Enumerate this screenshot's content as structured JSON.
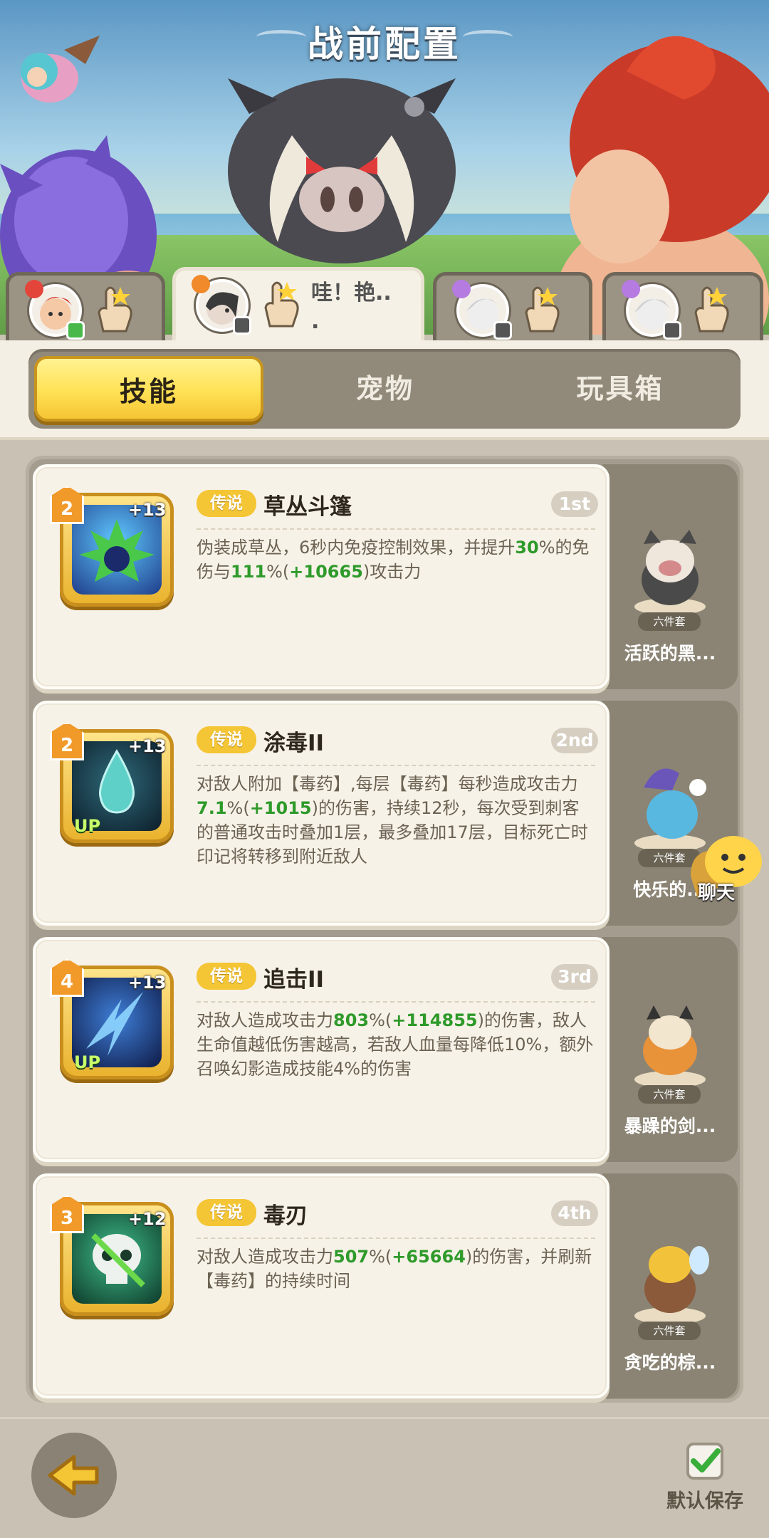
{
  "header": {
    "title": "战前配置"
  },
  "team": [
    {
      "role_color": "#e4453a",
      "badge": "chat"
    },
    {
      "role_color": "#f08a2a",
      "badge": "controller",
      "chat_snippet": "哇！艳..\n."
    },
    {
      "role_color": "#b57be0",
      "badge": "controller"
    },
    {
      "role_color": "#b57be0",
      "badge": "controller"
    }
  ],
  "category_tabs": [
    {
      "label": "技能",
      "active": true
    },
    {
      "label": "宠物",
      "active": false
    },
    {
      "label": "玩具箱",
      "active": false
    }
  ],
  "skills": [
    {
      "level": "2",
      "plus": "+13",
      "up": "",
      "rarity": "传说",
      "name": "草丛斗篷",
      "rank": "1st",
      "desc": [
        {
          "t": "伪装成草丛，6秒内免疫控制效果，并提升"
        },
        {
          "t": "30",
          "g": true
        },
        {
          "t": "%的免伤与"
        },
        {
          "t": "111",
          "g": true
        },
        {
          "t": "%("
        },
        {
          "t": "+10665",
          "g": true
        },
        {
          "t": ")攻击力"
        }
      ],
      "pet": {
        "name": "活跃的黑...",
        "tag": "六件套"
      },
      "icon": "bush-cloak-icon"
    },
    {
      "level": "2",
      "plus": "+13",
      "up": "UP",
      "rarity": "传说",
      "name": "涂毒II",
      "rank": "2nd",
      "desc": [
        {
          "t": "对敌人附加【毒药】,每层【毒药】每秒造成攻击力"
        },
        {
          "t": "7.1",
          "g": true
        },
        {
          "t": "%("
        },
        {
          "t": "+1015",
          "g": true
        },
        {
          "t": ")的伤害，持续12秒，每次受到刺客的普通攻击时叠加1层，最多叠加17层，目标死亡时印记将转移到附近敌人"
        }
      ],
      "pet": {
        "name": "快乐的...",
        "tag": "六件套"
      },
      "icon": "poison-drop-icon"
    },
    {
      "level": "4",
      "plus": "+13",
      "up": "UP",
      "rarity": "传说",
      "name": "追击II",
      "rank": "3rd",
      "desc": [
        {
          "t": "对敌人造成攻击力"
        },
        {
          "t": "803",
          "g": true
        },
        {
          "t": "%("
        },
        {
          "t": "+114855",
          "g": true
        },
        {
          "t": ")的伤害，敌人生命值越低伤害越高，若敌人血量每降低10%，额外召唤幻影造成技能4%的伤害"
        }
      ],
      "pet": {
        "name": "暴躁的剑...",
        "tag": "六件套"
      },
      "icon": "pursuit-icon"
    },
    {
      "level": "3",
      "plus": "+12",
      "up": "",
      "rarity": "传说",
      "name": "毒刃",
      "rank": "4th",
      "desc": [
        {
          "t": "对敌人造成攻击力"
        },
        {
          "t": "507",
          "g": true
        },
        {
          "t": "%("
        },
        {
          "t": "+65664",
          "g": true
        },
        {
          "t": ")的伤害，并刷新【毒药】的持续时间"
        }
      ],
      "pet": {
        "name": "贪吃的棕...",
        "tag": "六件套"
      },
      "icon": "poison-skull-icon"
    }
  ],
  "chat": {
    "label": "聊天"
  },
  "footer": {
    "save_label": "默认保存",
    "save_checked": true
  },
  "colors": {
    "accent_yellow": "#ffe155",
    "highlight_green": "#2e9a2a",
    "panel": "#a49d8f"
  }
}
